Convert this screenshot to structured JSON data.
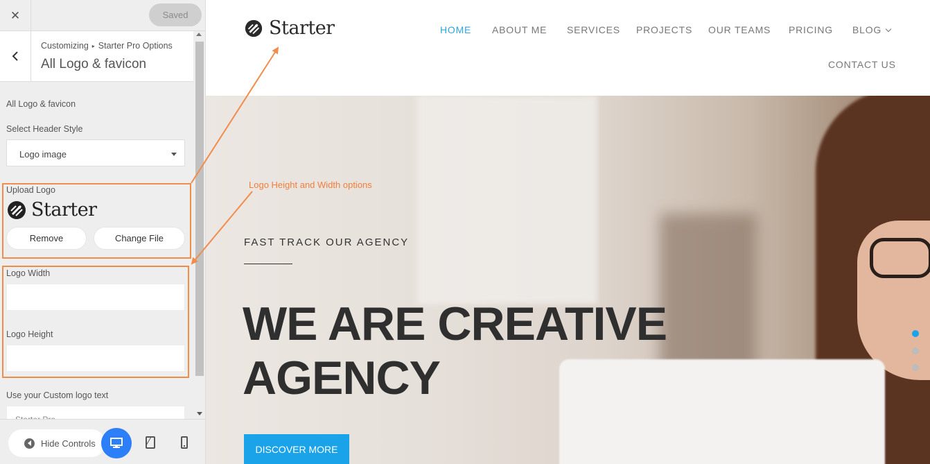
{
  "customizer": {
    "close_label": "✕",
    "saved_label": "Saved",
    "breadcrumb": {
      "root": "Customizing",
      "separator": "▸",
      "parent": "Starter Pro Options"
    },
    "section_title": "All Logo & favicon",
    "heading": "All Logo & favicon",
    "header_style": {
      "label": "Select Header Style",
      "value": "Logo image"
    },
    "upload_logo": {
      "label": "Upload Logo",
      "logo_text": "Starter",
      "remove_label": "Remove",
      "change_label": "Change File"
    },
    "logo_width": {
      "label": "Logo Width",
      "value": ""
    },
    "logo_height": {
      "label": "Logo Height",
      "value": ""
    },
    "custom_logo_text": {
      "label": "Use your Custom logo text",
      "value": "Starter Pro"
    },
    "footer": {
      "hide_controls_label": "Hide Controls"
    }
  },
  "preview": {
    "logo_text": "Starter",
    "nav": {
      "home": "HOME",
      "about": "ABOUT ME",
      "services": "SERVICES",
      "projects": "PROJECTS",
      "teams": "OUR TEAMS",
      "pricing": "PRICING",
      "blog": "BLOG",
      "contact": "CONTACT US"
    },
    "hero": {
      "eyebrow": "FAST TRACK OUR AGENCY",
      "title_line1": "WE ARE CREATIVE",
      "title_line2": "AGENCY",
      "cta_label": "DISCOVER MORE"
    },
    "slider": {
      "total": 3,
      "active": 1
    }
  },
  "annotation": {
    "text": "Logo Height and Width options",
    "color": "#f07e3c"
  },
  "colors": {
    "accent": "#2fa6d9",
    "button": "#1aa3e8",
    "device_active": "#2d7ff9",
    "highlight": "#f08c4c"
  }
}
